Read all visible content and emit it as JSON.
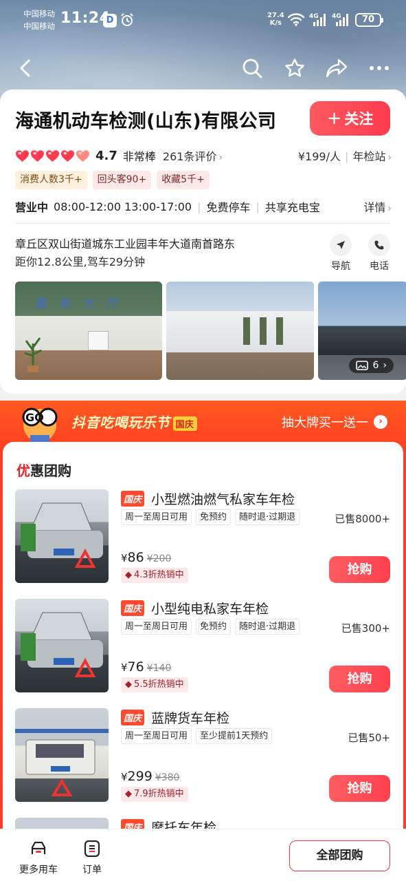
{
  "status_bar": {
    "carrier1": "中国移动",
    "carrier2": "中国移动",
    "time": "11:24",
    "app_icon_letter": "D",
    "net_speed_value": "27.4",
    "net_speed_unit": "K/s",
    "signal1": "4G",
    "signal2": "4G",
    "battery": "70"
  },
  "nav": {
    "icons": [
      "back-icon",
      "search-icon",
      "star-icon",
      "share-icon",
      "more-icon"
    ]
  },
  "shop": {
    "name": "海通机动车检测(山东)有限公司",
    "follow_label": "关注",
    "hearts": 5,
    "score": "4.7",
    "score_word": "非常棒",
    "reviews": "261条评价",
    "price_per_person": "¥199/人",
    "category": "年检站",
    "tags": [
      "消费人数3千+",
      "回头客90+",
      "收藏5千+"
    ],
    "status": "营业中",
    "hours": "08:00-12:00 13:00-17:00",
    "feature1": "免费停车",
    "feature2": "共享充电宝",
    "details_label": "详情",
    "address": "章丘区双山街道城东工业园丰年大道南首路东",
    "distance": "距你12.8公里,驾车29分钟",
    "nav_label": "导航",
    "call_label": "电话",
    "photo_sign": "服 务 大 厅",
    "photo_count": "6"
  },
  "festival": {
    "mascot_text": "GO",
    "title": "抖音吃喝玩乐节",
    "badge": "国庆",
    "promo": "抽大牌买一送一"
  },
  "deals_section": {
    "title_first": "优",
    "title_rest": "惠团购"
  },
  "deals": [
    {
      "badge": "国庆",
      "name": "小型燃油燃气私家车年检",
      "tags": [
        "周一至周日可用",
        "免预约",
        "随时退·过期退"
      ],
      "sold": "已售8000+",
      "price": "86",
      "original": "¥200",
      "hot": "4.3折热销中",
      "buy": "抢购"
    },
    {
      "badge": "国庆",
      "name": "小型纯电私家车年检",
      "tags": [
        "周一至周日可用",
        "免预约",
        "随时退·过期退"
      ],
      "sold": "已售300+",
      "price": "76",
      "original": "¥140",
      "hot": "5.5折热销中",
      "buy": "抢购"
    },
    {
      "badge": "国庆",
      "name": "蓝牌货车年检",
      "tags": [
        "周一至周日可用",
        "至少提前1天预约"
      ],
      "sold": "已售50+",
      "price": "299",
      "original": "¥380",
      "hot": "7.9折热销中",
      "buy": "抢购"
    },
    {
      "badge": "国庆",
      "name": "摩托车年检"
    }
  ],
  "bottom_bar": {
    "more_cars": "更多用车",
    "orders": "订单",
    "all_deals": "全部团购"
  },
  "colors": {
    "accent": "#ff414f",
    "festival": "#ff3d28",
    "badge": "#ff4a2e"
  }
}
